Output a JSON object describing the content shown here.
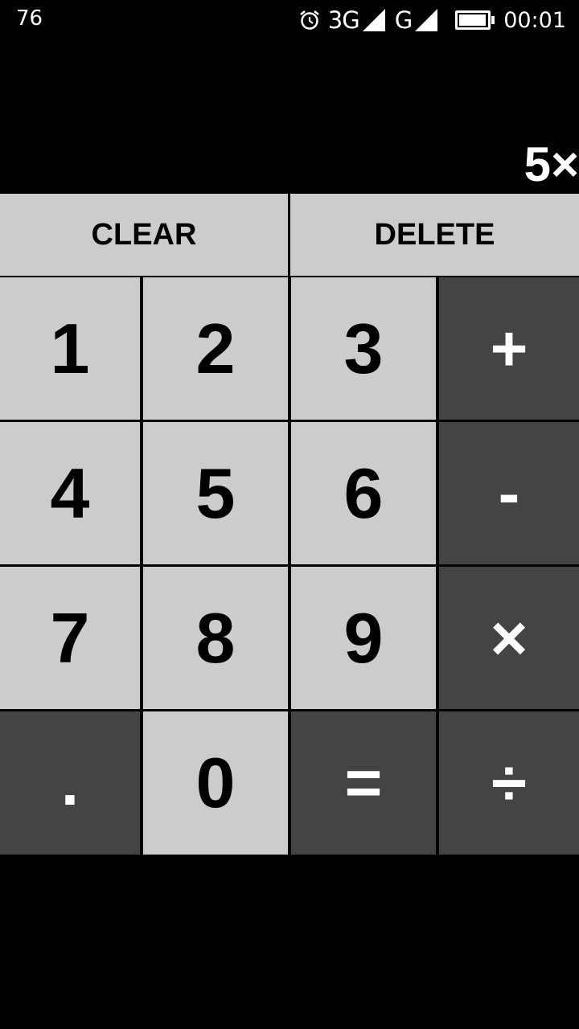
{
  "status_bar": {
    "left_text": "76",
    "icons": [
      "alarm-icon",
      "signal-3g-icon",
      "signal-g-icon",
      "battery-icon"
    ],
    "network_1": "3G",
    "network_2": "G",
    "time": "00:01"
  },
  "display": {
    "expression": "5×"
  },
  "colors": {
    "light_key": "#cccccc",
    "dark_key": "#444444",
    "background": "#000000"
  },
  "keys": {
    "clear": "CLEAR",
    "delete": "DELETE",
    "one": "1",
    "two": "2",
    "three": "3",
    "plus": "+",
    "four": "4",
    "five": "5",
    "six": "6",
    "minus": "-",
    "seven": "7",
    "eight": "8",
    "nine": "9",
    "multiply": "×",
    "dot": ".",
    "zero": "0",
    "equals": "=",
    "divide": "÷"
  }
}
